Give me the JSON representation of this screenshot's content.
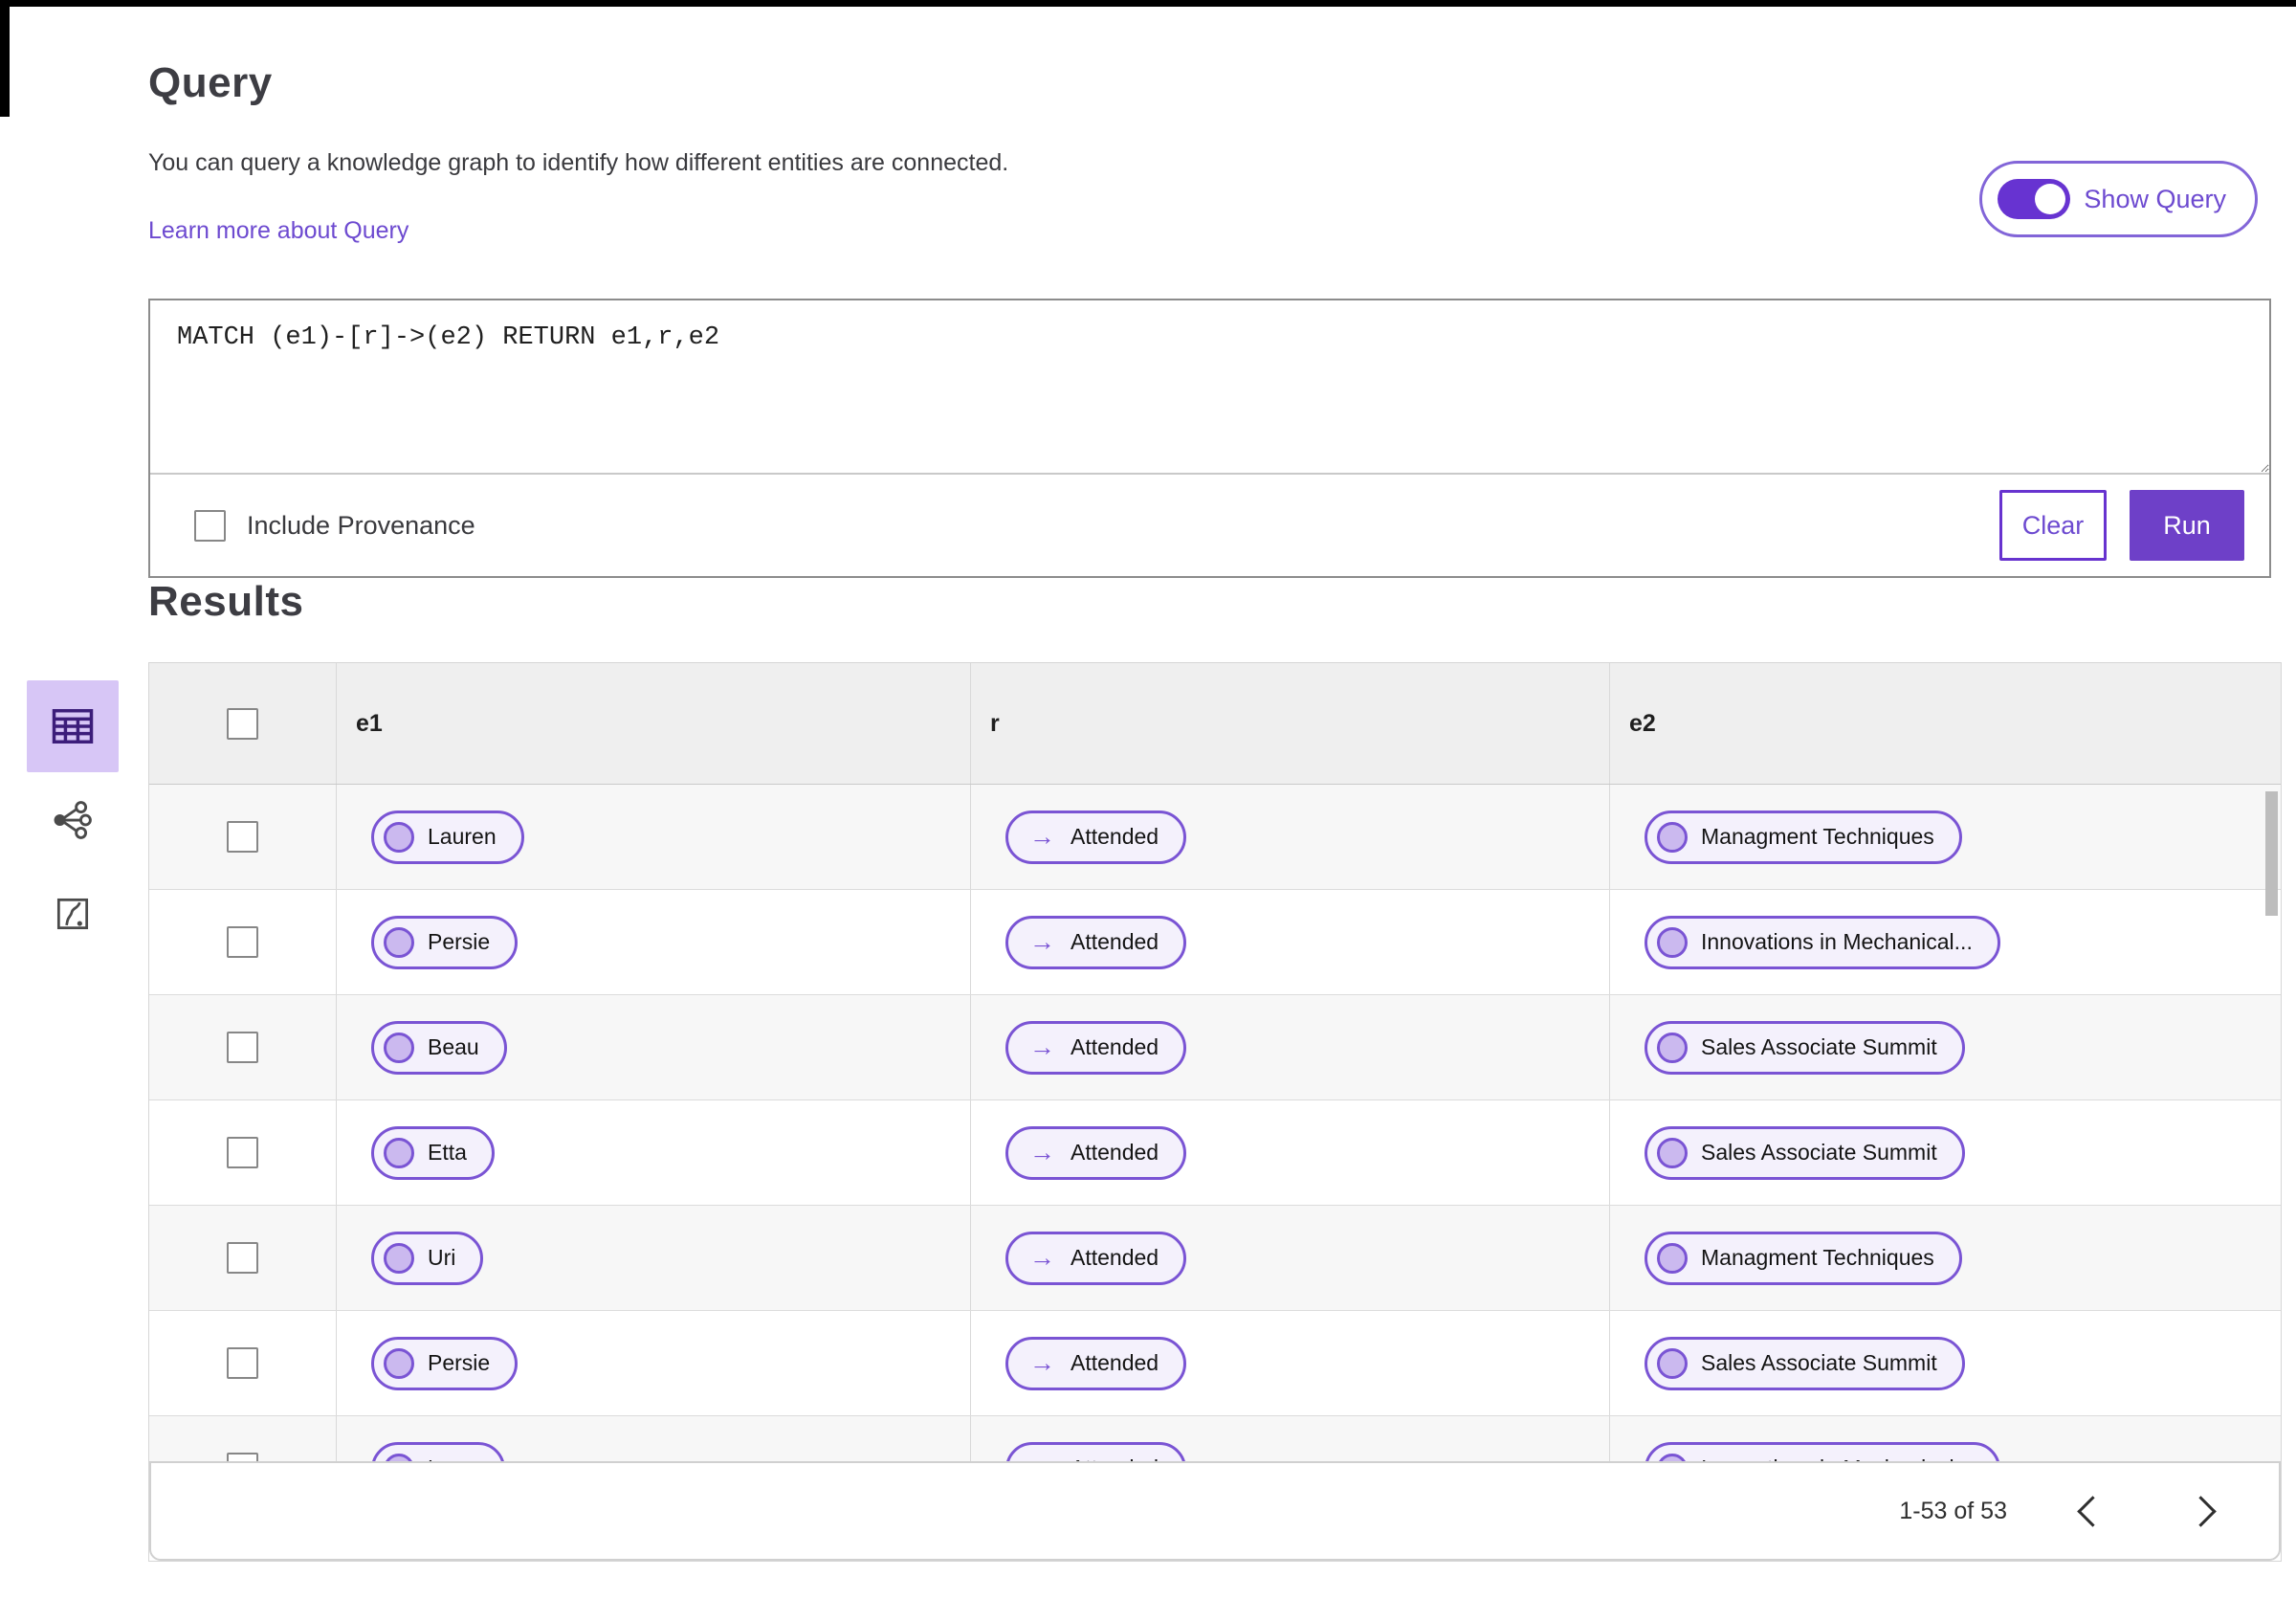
{
  "header": {
    "title": "Query",
    "description": "You can query a knowledge graph to identify how different entities are connected.",
    "learn_more_label": "Learn more about Query",
    "show_query_label": "Show Query",
    "show_query_state": "on"
  },
  "query_editor": {
    "query_text": "MATCH (e1)-[r]->(e2) RETURN e1,r,e2",
    "include_provenance_label": "Include Provenance",
    "include_provenance_checked": false,
    "clear_button_label": "Clear",
    "run_button_label": "Run"
  },
  "view_rail": {
    "items": [
      {
        "name": "table-view",
        "icon": "table-grid-icon",
        "selected": true
      },
      {
        "name": "graph-view",
        "icon": "network-share-icon",
        "selected": false
      },
      {
        "name": "map-view",
        "icon": "map-route-icon",
        "selected": false
      }
    ]
  },
  "results": {
    "title": "Results",
    "columns": [
      "e1",
      "r",
      "e2"
    ],
    "rows": [
      {
        "e1": "Lauren",
        "r": "Attended",
        "e2": "Managment Techniques"
      },
      {
        "e1": "Persie",
        "r": "Attended",
        "e2": "Innovations in Mechanical..."
      },
      {
        "e1": "Beau",
        "r": "Attended",
        "e2": "Sales Associate Summit"
      },
      {
        "e1": "Etta",
        "r": "Attended",
        "e2": "Sales Associate Summit"
      },
      {
        "e1": "Uri",
        "r": "Attended",
        "e2": "Managment Techniques"
      },
      {
        "e1": "Persie",
        "r": "Attended",
        "e2": "Sales Associate Summit"
      },
      {
        "e1": "Larry",
        "r": "Attended",
        "e2": "Innovations in Mechanical..."
      }
    ],
    "pagination": {
      "range_label": "1-53 of 53",
      "prev_icon": "chevron-left-icon",
      "next_icon": "chevron-right-icon"
    }
  },
  "icons": {
    "arrow_right": "→"
  },
  "colors": {
    "accent": "#6e40c8",
    "toggle_track": "#6733d1",
    "pill_border": "#7a54d4",
    "pill_bg": "#f4f1fc",
    "entity_dot_fill": "#cbb9ef",
    "selected_view_bg": "#d7c6f6",
    "table_header_bg": "#efefef",
    "row_alt_bg": "#f7f7f7",
    "grid_border": "#d9d9d9",
    "link_text": "#6d4ad0"
  }
}
